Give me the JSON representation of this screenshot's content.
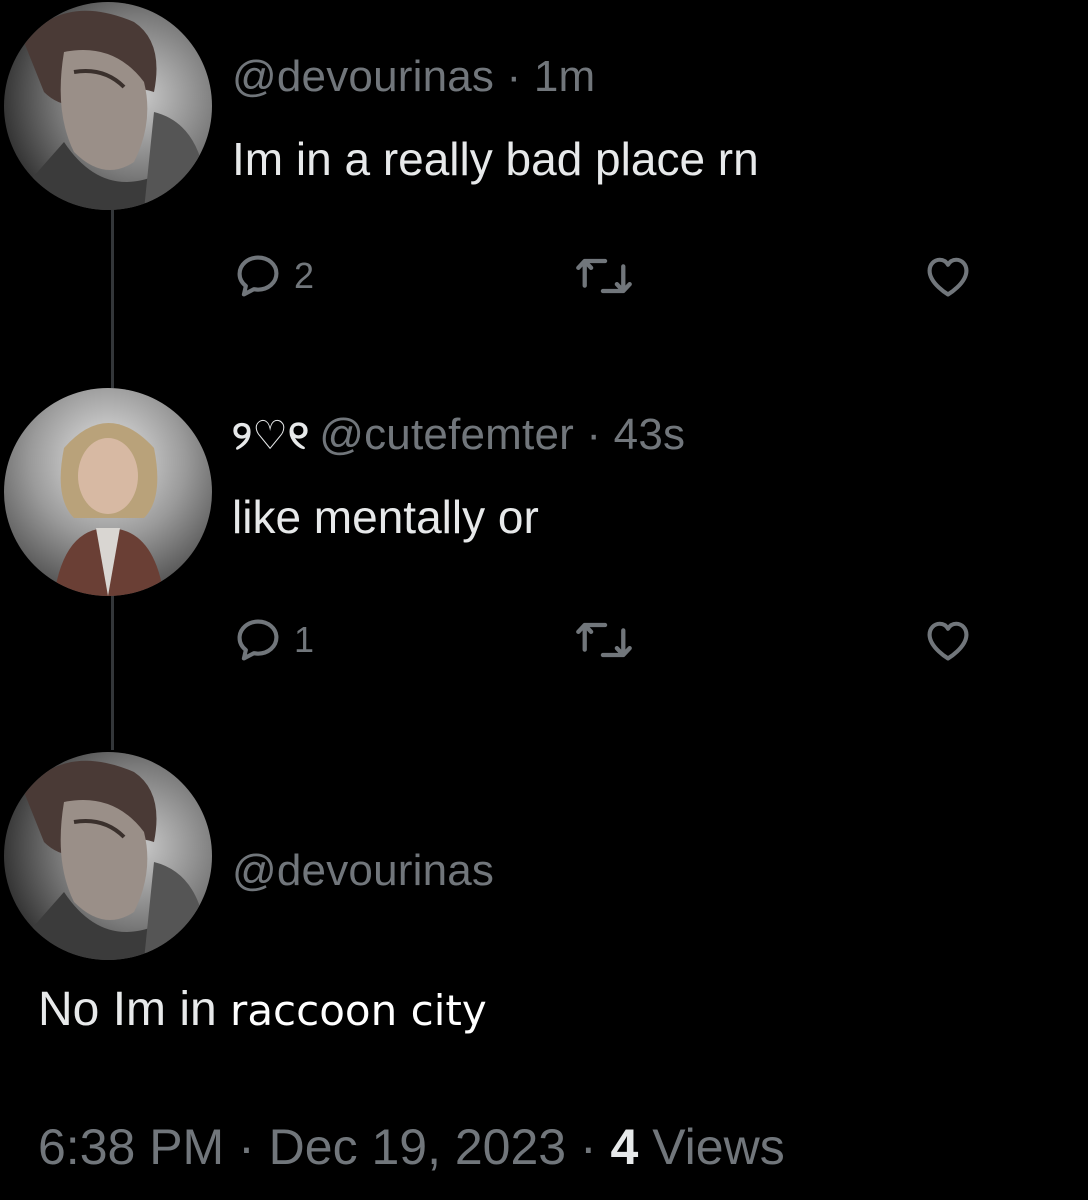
{
  "tweets": [
    {
      "handle": "@devourinas",
      "separator": " · ",
      "time": "1m",
      "text": "Im in a really bad place rn",
      "reply_count": "2"
    },
    {
      "display_name": "୨♡୧",
      "handle": "@cutefemter",
      "separator": " · ",
      "time": "43s",
      "text": "like mentally or",
      "reply_count": "1"
    }
  ],
  "main_tweet": {
    "handle": "@devourinas",
    "text_part1": "No Im in ",
    "text_part2": "raccoon city",
    "time": "6:38 PM",
    "sep1": " · ",
    "date": "Dec 19, 2023",
    "sep2": " · ",
    "views_count": "4",
    "views_label": " Views"
  },
  "colors": {
    "background": "#000000",
    "text": "#e7e9ea",
    "secondary": "#71767b",
    "thread_line": "#333639"
  },
  "icons": {
    "reply": "speech-bubble-icon",
    "retweet": "retweet-icon",
    "like": "heart-icon"
  }
}
